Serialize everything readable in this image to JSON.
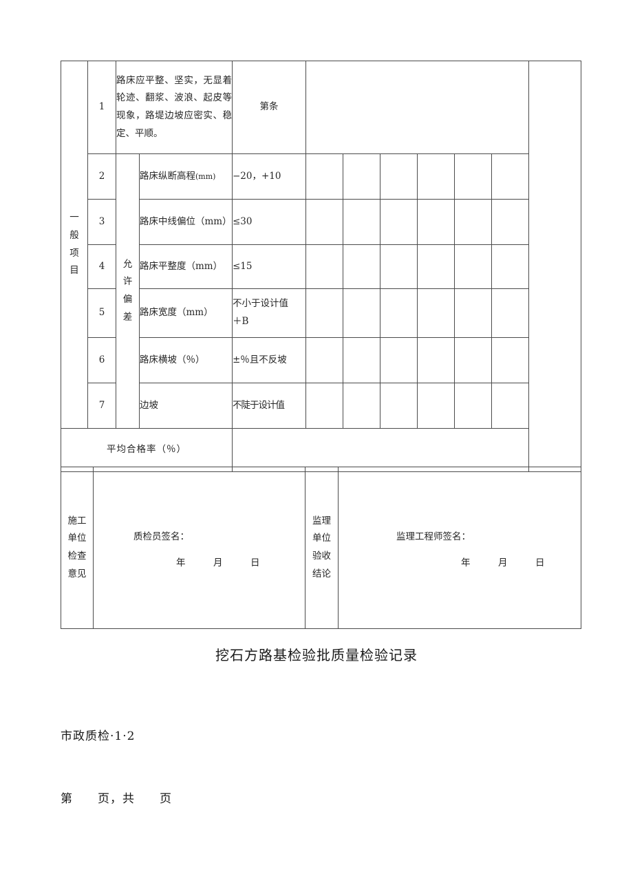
{
  "document": {
    "title": "挖石方路基检验批质量检验记录",
    "form_code": "市政质检·1·2",
    "page_line": "第　　页，共　　页"
  },
  "table": {
    "category_label": "一般项目",
    "tolerance_label": "允许偏差",
    "rows": [
      {
        "no": "1",
        "name": "路床应平整、坚实，无显着轮迹、翻浆、波浪、起皮等现象，路堤边坡应密实、稳定、平顺。",
        "value": "第条",
        "merged_name": true,
        "checks": []
      },
      {
        "no": "2",
        "name": "路床纵断高程",
        "unit": "(mm)",
        "value": "−20，+10",
        "checks": [
          "",
          "",
          "",
          "",
          "",
          ""
        ]
      },
      {
        "no": "3",
        "name": "路床中线偏位（mm）",
        "value": "≤30",
        "checks": [
          "",
          "",
          "",
          "",
          "",
          ""
        ]
      },
      {
        "no": "4",
        "name": "路床平整度（mm）",
        "value": "≤15",
        "checks": [
          "",
          "",
          "",
          "",
          "",
          ""
        ]
      },
      {
        "no": "5",
        "name": "路床宽度（mm）",
        "value": "不小于设计值\n＋B",
        "checks": [
          "",
          "",
          "",
          "",
          "",
          ""
        ]
      },
      {
        "no": "6",
        "name": "路床横坡（％）",
        "value": "±％且不反坡",
        "checks": [
          "",
          "",
          "",
          "",
          "",
          ""
        ]
      },
      {
        "no": "7",
        "name": "边坡",
        "value": "不陡于设计值",
        "checks": [
          "",
          "",
          "",
          "",
          "",
          ""
        ]
      }
    ],
    "average_pass_rate_label": "平均合格率（％）",
    "average_pass_rate_value": ""
  },
  "signatures": {
    "construction_unit": {
      "side_label": "施工单位检查意见",
      "title": "质检员签名：",
      "date_line": "年　　　月　　　日",
      "content": ""
    },
    "supervision_unit": {
      "side_label": "监理单位验收结论",
      "title": "监理工程师签名：",
      "date_line": "年　　　月　　　日",
      "content": ""
    }
  }
}
